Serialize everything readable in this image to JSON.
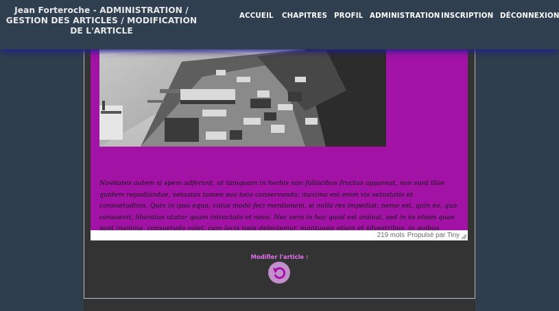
{
  "header": {
    "title": "Jean Forteroche - ADMINISTRATION / GESTION DES ARTICLES / MODIFICATION DE L'ARTICLE",
    "nav": [
      "ACCUEIL",
      "CHAPITRES",
      "PROFIL",
      "ADMINISTRATION",
      "INSCRIPTION",
      "DÉCONNEXION"
    ]
  },
  "editor": {
    "text": "Novitates autem si spem adferunt, ut tamquam in herbis non fallacibus fructus appareat, non sunt illae quidem repudiandae, vetustas tamen suo loco conservanda; maxima est enim vis vetustatis et consuetudinis. Quin in ipso equo, cuius modo feci mentionem, si nulla res impediat, nemo est, quin eo, quo consuevit, libentius utatur quam intractato et novo. Nec vero in hoc quod est animal, sed in iis etiam quae sunt inanima, consuetudo valet, cum locis ipsis delectemur, montuosis etiam et silvestribus, in quibus diutius commorati sumus.",
    "word_count": "219 mots",
    "powered_by": "Propulsé par Tiny"
  },
  "modify": {
    "label": "Modifier l'article :",
    "icon": "undo-arrow-icon"
  },
  "colors": {
    "header_bg": "#2f3f4f",
    "editor_bg": "#a213a5",
    "panel_bg": "#333333",
    "accent": "#e070e8",
    "button": "#c08fcc"
  }
}
